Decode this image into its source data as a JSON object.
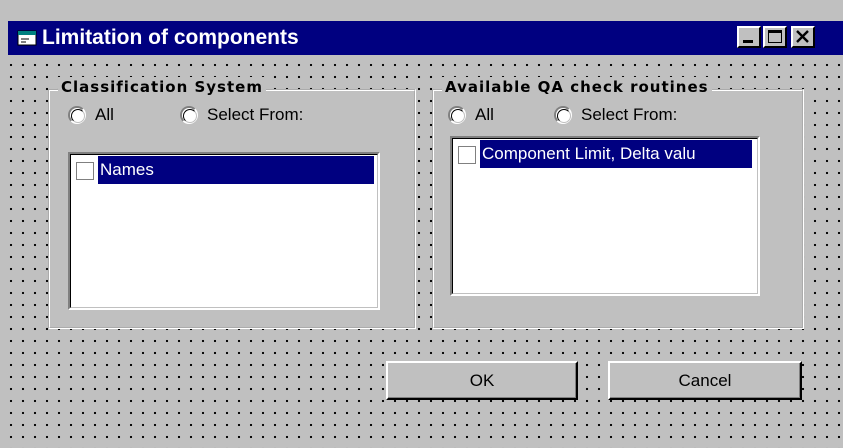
{
  "window": {
    "title": "Limitation of components"
  },
  "classification": {
    "legend": "Classification System",
    "radio_all": "All",
    "radio_select": "Select From:",
    "items": [
      "Names"
    ]
  },
  "qa_routines": {
    "legend": "Available QA check routines",
    "radio_all": "All",
    "radio_select": "Select From:",
    "items": [
      "Component Limit, Delta valu"
    ]
  },
  "buttons": {
    "ok": "OK",
    "cancel": "Cancel"
  },
  "colors": {
    "titlebar": "#000080",
    "face": "#c0c0c0",
    "selection": "#000080"
  }
}
